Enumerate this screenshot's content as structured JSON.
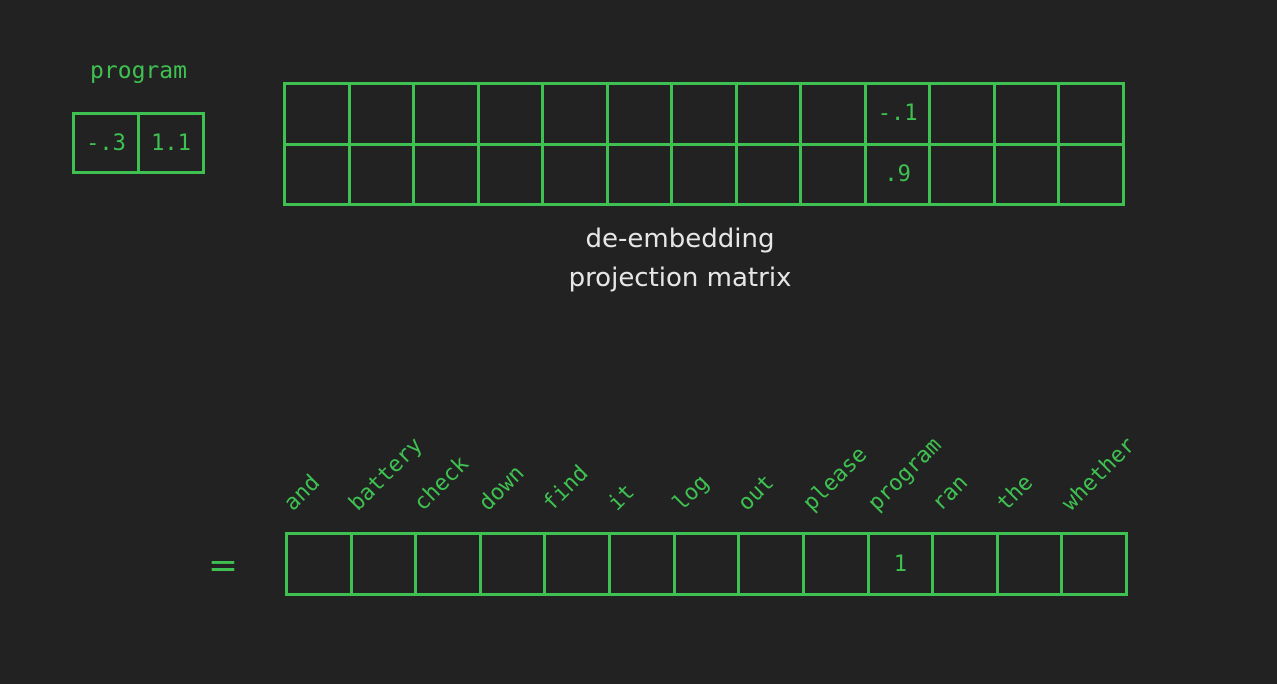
{
  "input_vector": {
    "label": "program",
    "values": [
      "-.3",
      "1.1"
    ]
  },
  "projection_matrix": {
    "rows": [
      [
        "",
        "",
        "",
        "",
        "",
        "",
        "",
        "",
        "",
        "-.1",
        "",
        "",
        ""
      ],
      [
        "",
        "",
        "",
        "",
        "",
        "",
        "",
        "",
        "",
        ".9",
        "",
        "",
        ""
      ]
    ],
    "caption_line1": "de-embedding",
    "caption_line2": "projection matrix"
  },
  "equals": "=",
  "vocabulary": [
    "and",
    "battery",
    "check",
    "down",
    "find",
    "it",
    "log",
    "out",
    "please",
    "program",
    "ran",
    "the",
    "whether"
  ],
  "output_vector": {
    "values": [
      "",
      "",
      "",
      "",
      "",
      "",
      "",
      "",
      "",
      "1",
      "",
      "",
      ""
    ]
  },
  "colors": {
    "background": "#222222",
    "accent": "#3ec151",
    "caption": "#e6e6e6"
  }
}
